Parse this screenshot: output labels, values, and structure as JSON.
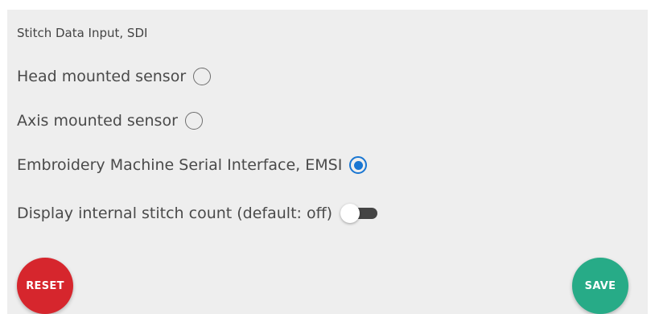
{
  "section": {
    "title": "Stitch Data Input, SDI"
  },
  "options": [
    {
      "label": "Head mounted sensor",
      "selected": false
    },
    {
      "label": "Axis mounted sensor",
      "selected": false
    },
    {
      "label": "Embroidery Machine Serial Interface, EMSI",
      "selected": true
    }
  ],
  "toggle": {
    "label": "Display internal stitch count (default: off)",
    "on": false
  },
  "buttons": {
    "reset_label": "RESET",
    "save_label": "SAVE"
  },
  "colors": {
    "accent": "#1976d2",
    "reset": "#d6262d",
    "save": "#27ab87",
    "panel": "#eeeeee"
  }
}
